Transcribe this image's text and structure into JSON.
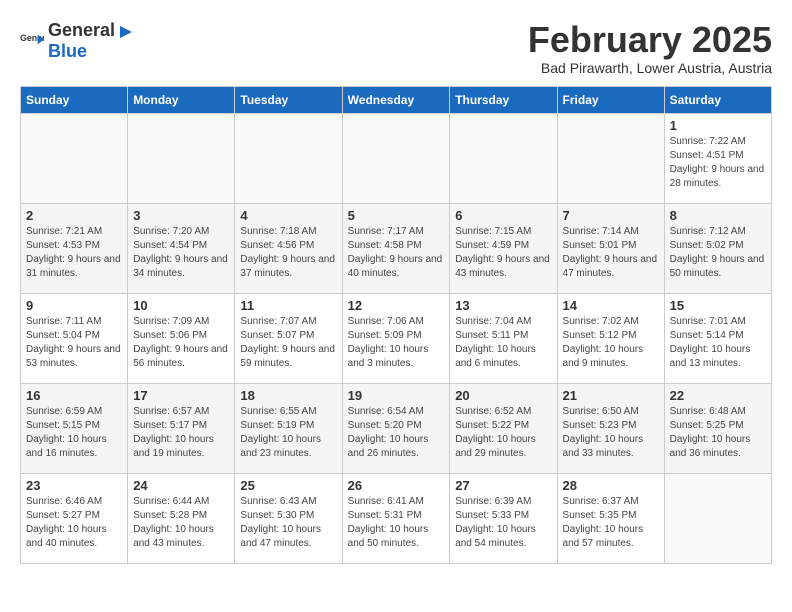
{
  "header": {
    "logo_general": "General",
    "logo_blue": "Blue",
    "title": "February 2025",
    "subtitle": "Bad Pirawarth, Lower Austria, Austria"
  },
  "weekdays": [
    "Sunday",
    "Monday",
    "Tuesday",
    "Wednesday",
    "Thursday",
    "Friday",
    "Saturday"
  ],
  "weeks": [
    [
      {
        "day": "",
        "info": ""
      },
      {
        "day": "",
        "info": ""
      },
      {
        "day": "",
        "info": ""
      },
      {
        "day": "",
        "info": ""
      },
      {
        "day": "",
        "info": ""
      },
      {
        "day": "",
        "info": ""
      },
      {
        "day": "1",
        "info": "Sunrise: 7:22 AM\nSunset: 4:51 PM\nDaylight: 9 hours and 28 minutes."
      }
    ],
    [
      {
        "day": "2",
        "info": "Sunrise: 7:21 AM\nSunset: 4:53 PM\nDaylight: 9 hours and 31 minutes."
      },
      {
        "day": "3",
        "info": "Sunrise: 7:20 AM\nSunset: 4:54 PM\nDaylight: 9 hours and 34 minutes."
      },
      {
        "day": "4",
        "info": "Sunrise: 7:18 AM\nSunset: 4:56 PM\nDaylight: 9 hours and 37 minutes."
      },
      {
        "day": "5",
        "info": "Sunrise: 7:17 AM\nSunset: 4:58 PM\nDaylight: 9 hours and 40 minutes."
      },
      {
        "day": "6",
        "info": "Sunrise: 7:15 AM\nSunset: 4:59 PM\nDaylight: 9 hours and 43 minutes."
      },
      {
        "day": "7",
        "info": "Sunrise: 7:14 AM\nSunset: 5:01 PM\nDaylight: 9 hours and 47 minutes."
      },
      {
        "day": "8",
        "info": "Sunrise: 7:12 AM\nSunset: 5:02 PM\nDaylight: 9 hours and 50 minutes."
      }
    ],
    [
      {
        "day": "9",
        "info": "Sunrise: 7:11 AM\nSunset: 5:04 PM\nDaylight: 9 hours and 53 minutes."
      },
      {
        "day": "10",
        "info": "Sunrise: 7:09 AM\nSunset: 5:06 PM\nDaylight: 9 hours and 56 minutes."
      },
      {
        "day": "11",
        "info": "Sunrise: 7:07 AM\nSunset: 5:07 PM\nDaylight: 9 hours and 59 minutes."
      },
      {
        "day": "12",
        "info": "Sunrise: 7:06 AM\nSunset: 5:09 PM\nDaylight: 10 hours and 3 minutes."
      },
      {
        "day": "13",
        "info": "Sunrise: 7:04 AM\nSunset: 5:11 PM\nDaylight: 10 hours and 6 minutes."
      },
      {
        "day": "14",
        "info": "Sunrise: 7:02 AM\nSunset: 5:12 PM\nDaylight: 10 hours and 9 minutes."
      },
      {
        "day": "15",
        "info": "Sunrise: 7:01 AM\nSunset: 5:14 PM\nDaylight: 10 hours and 13 minutes."
      }
    ],
    [
      {
        "day": "16",
        "info": "Sunrise: 6:59 AM\nSunset: 5:15 PM\nDaylight: 10 hours and 16 minutes."
      },
      {
        "day": "17",
        "info": "Sunrise: 6:57 AM\nSunset: 5:17 PM\nDaylight: 10 hours and 19 minutes."
      },
      {
        "day": "18",
        "info": "Sunrise: 6:55 AM\nSunset: 5:19 PM\nDaylight: 10 hours and 23 minutes."
      },
      {
        "day": "19",
        "info": "Sunrise: 6:54 AM\nSunset: 5:20 PM\nDaylight: 10 hours and 26 minutes."
      },
      {
        "day": "20",
        "info": "Sunrise: 6:52 AM\nSunset: 5:22 PM\nDaylight: 10 hours and 29 minutes."
      },
      {
        "day": "21",
        "info": "Sunrise: 6:50 AM\nSunset: 5:23 PM\nDaylight: 10 hours and 33 minutes."
      },
      {
        "day": "22",
        "info": "Sunrise: 6:48 AM\nSunset: 5:25 PM\nDaylight: 10 hours and 36 minutes."
      }
    ],
    [
      {
        "day": "23",
        "info": "Sunrise: 6:46 AM\nSunset: 5:27 PM\nDaylight: 10 hours and 40 minutes."
      },
      {
        "day": "24",
        "info": "Sunrise: 6:44 AM\nSunset: 5:28 PM\nDaylight: 10 hours and 43 minutes."
      },
      {
        "day": "25",
        "info": "Sunrise: 6:43 AM\nSunset: 5:30 PM\nDaylight: 10 hours and 47 minutes."
      },
      {
        "day": "26",
        "info": "Sunrise: 6:41 AM\nSunset: 5:31 PM\nDaylight: 10 hours and 50 minutes."
      },
      {
        "day": "27",
        "info": "Sunrise: 6:39 AM\nSunset: 5:33 PM\nDaylight: 10 hours and 54 minutes."
      },
      {
        "day": "28",
        "info": "Sunrise: 6:37 AM\nSunset: 5:35 PM\nDaylight: 10 hours and 57 minutes."
      },
      {
        "day": "",
        "info": ""
      }
    ]
  ]
}
